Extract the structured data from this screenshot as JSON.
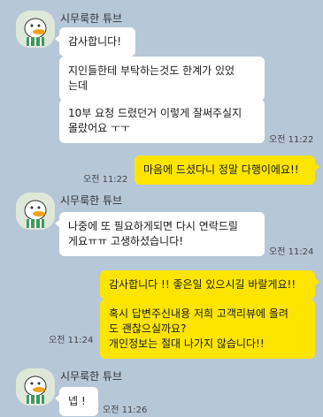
{
  "sender_name": "시무룩한 튜브",
  "messages": [
    {
      "text": "감사합니다!"
    },
    {
      "text": "지인들한테 부탁하는것도 한계가 있었\n는데"
    },
    {
      "text": "10부 요청 드렸던거 이렇게 잘써주실지\n몰랐어요 ㅜㅜ",
      "time": "오전 11:22"
    },
    {
      "text": "마음에 드셨다니 정말 다행이에요!!",
      "time": "오전 11:22"
    },
    {
      "text": "나중에 또 필요하게되면 다시 연락드릴\n게요ㅠㅠ 고생하셨습니다!",
      "time": "오전 11:24"
    },
    {
      "text": "감사합니다 !! 좋은일 있으시길 바랄게요!!"
    },
    {
      "text": "혹시 답변주신내용 저희 고객리뷰에 올려\n도 괜찮으실까요?\n개인정보는 절대 나가지 않습니다!!",
      "time": "오전 11:24"
    },
    {
      "text": "넵 !",
      "time": "오전 11:26"
    }
  ],
  "colors": {
    "background": "#b6c7d8",
    "my_bubble": "#fee500",
    "their_bubble": "#ffffff"
  },
  "avatar_icon": "duck-tube-avatar-icon"
}
